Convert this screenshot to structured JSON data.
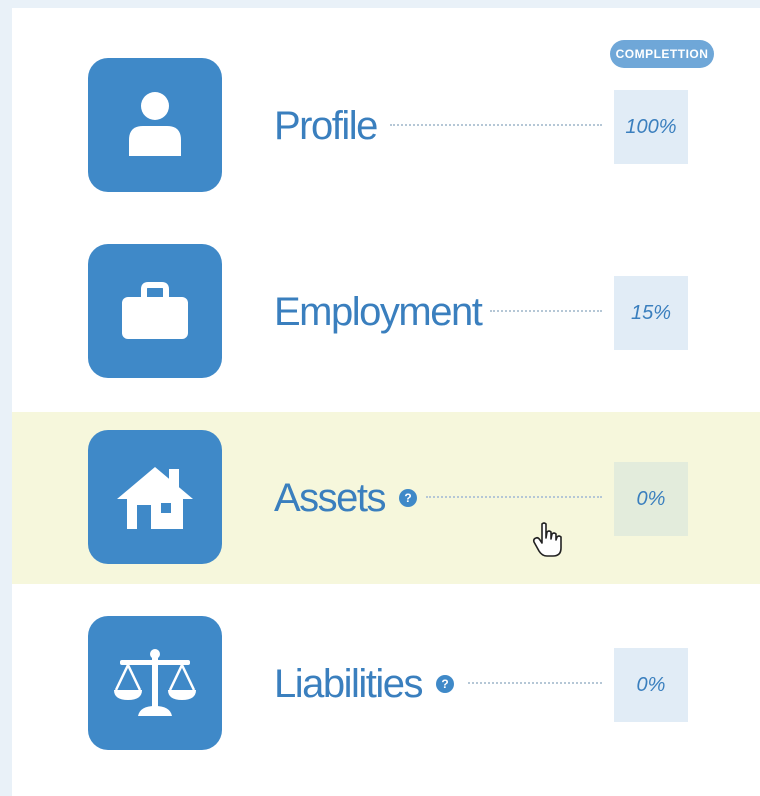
{
  "header": {
    "badge_label": "COMPLETTION"
  },
  "rows": [
    {
      "name": "Profile",
      "icon": "person-icon",
      "completion": "100%",
      "has_help": false,
      "highlighted": false
    },
    {
      "name": "Employment",
      "icon": "briefcase-icon",
      "completion": "15%",
      "has_help": false,
      "highlighted": false
    },
    {
      "name": "Assets",
      "icon": "house-icon",
      "completion": "0%",
      "has_help": true,
      "help_symbol": "?",
      "highlighted": true
    },
    {
      "name": "Liabilities",
      "icon": "scales-icon",
      "completion": "0%",
      "has_help": true,
      "help_symbol": "?",
      "highlighted": false
    }
  ],
  "colors": {
    "accent": "#3f89c8",
    "label_text": "#3a7fbe",
    "badge_bg": "#6fa7d8",
    "highlight_row": "#f6f7dc",
    "percent_box": "#e1ecf6"
  }
}
